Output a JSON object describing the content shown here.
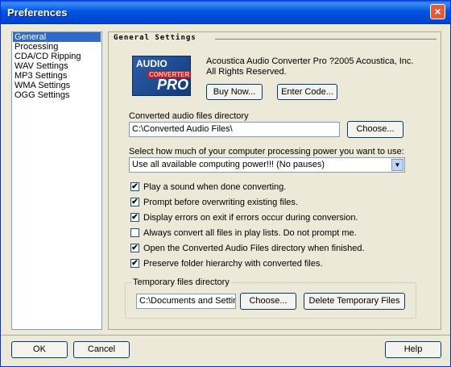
{
  "window": {
    "title": "Preferences",
    "close_icon": "×"
  },
  "sidebar": {
    "items": [
      {
        "label": "General",
        "selected": true
      },
      {
        "label": "Processing"
      },
      {
        "label": "CDA/CD Ripping"
      },
      {
        "label": "WAV Settings"
      },
      {
        "label": "MP3 Settings"
      },
      {
        "label": "WMA Settings"
      },
      {
        "label": "OGG Settings"
      }
    ]
  },
  "panel": {
    "header": "General Settings",
    "logo": {
      "line1": "AUDIO",
      "line2": "CONVERTER",
      "line3": "PRO"
    },
    "copyright": "Acoustica Audio Converter Pro ?2005 Acoustica, Inc. All Rights Reserved.",
    "buy_now_label": "Buy Now...",
    "enter_code_label": "Enter Code...",
    "converted_dir_label": "Converted audio files directory",
    "converted_dir_value": "C:\\Converted Audio Files\\",
    "choose_label": "Choose...",
    "processing_label": "Select how much of your computer processing power you want to use:",
    "processing_value": "Use all available computing power!!! (No pauses)",
    "checkboxes": [
      {
        "label": "Play a sound when done converting.",
        "checked": true
      },
      {
        "label": "Prompt before overwriting existing files.",
        "checked": true
      },
      {
        "label": "Display errors on exit if errors occur during conversion.",
        "checked": true
      },
      {
        "label": "Always convert all files in play lists.  Do not prompt me.",
        "checked": false
      },
      {
        "label": "Open the Converted Audio Files directory when finished.",
        "checked": true
      },
      {
        "label": "Preserve folder hierarchy with converted files.",
        "checked": true
      }
    ],
    "temp_dir_label": "Temporary files directory",
    "temp_dir_value": "C:\\Documents and Setting",
    "temp_choose_label": "Choose...",
    "delete_temp_label": "Delete Temporary Files"
  },
  "footer": {
    "ok_label": "OK",
    "cancel_label": "Cancel",
    "help_label": "Help"
  },
  "icons": {
    "check": "✔",
    "dropdown": "▼"
  }
}
